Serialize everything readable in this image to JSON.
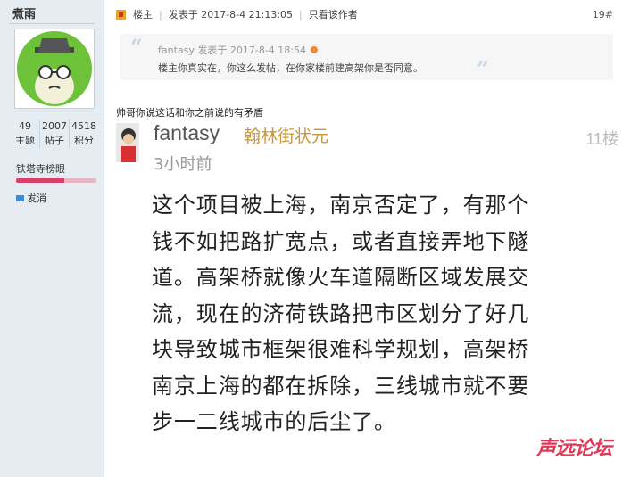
{
  "user": {
    "name": "煮雨",
    "stats": [
      {
        "value": "49",
        "label": "主题"
      },
      {
        "value": "2007",
        "label": "帖子"
      },
      {
        "value": "4518",
        "label": "积分"
      }
    ],
    "rank": "铁塔寺榜眼",
    "rank_progress": 0.6,
    "message_label": "发消"
  },
  "post_header": {
    "owner_label": "楼主",
    "posted_at": "发表于 2017-8-4 21:13:05",
    "only_author": "只看该作者",
    "floor": "19#"
  },
  "quote": {
    "author_line": "fantasy 发表于 2017-8-4 18:54",
    "text": "楼主你真实在，你这么发帖，在你家楼前建高架你是否同意。"
  },
  "reply_title": "帅哥你说这话和你之前说的有矛盾",
  "card": {
    "author": "fantasy",
    "title": "翰林街状元",
    "floor": "11楼",
    "time": "3小时前",
    "lines": [
      "这个项目被上海，南京否定了，有那个",
      "钱不如把路扩宽点，或者直接弄地下隧",
      "道。高架桥就像火车道隔断区域发展交",
      "流，现在的济荷铁路把市区划分了好几",
      "块导致城市框架很难科学规划，高架桥",
      "南京上海的都在拆除，三线城市就不要",
      "步一二线城市的后尘了。"
    ]
  },
  "watermark": "声远论坛",
  "colors": {
    "sidebar_bg": "#e5edf2",
    "title_gold": "#c9963a",
    "watermark": "#e03a5a"
  }
}
